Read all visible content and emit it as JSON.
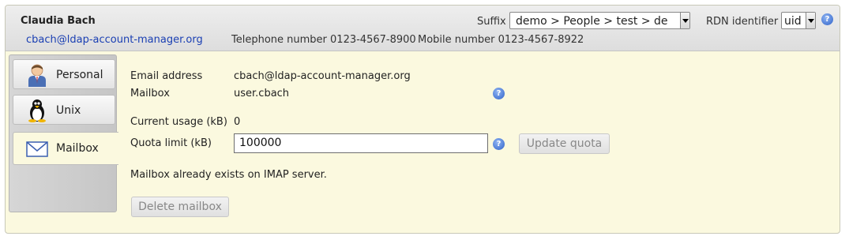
{
  "header": {
    "user_name": "Claudia Bach",
    "email": "cbach@ldap-account-manager.org",
    "telephone": "Telephone number 0123-4567-8900",
    "mobile": "Mobile number 0123-4567-8922",
    "suffix_label": "Suffix",
    "suffix_value": "demo > People > test > de",
    "rdn_label": "RDN identifier",
    "rdn_value": "uid",
    "help_glyph": "?"
  },
  "sidebar": {
    "items": [
      {
        "label": "Personal",
        "icon": "personal-user-icon"
      },
      {
        "label": "Unix",
        "icon": "tux-penguin-icon"
      },
      {
        "label": "Mailbox",
        "icon": "envelope-icon",
        "active": true
      }
    ]
  },
  "main": {
    "email_label": "Email address",
    "email_value": "cbach@ldap-account-manager.org",
    "mailbox_label": "Mailbox",
    "mailbox_value": "user.cbach",
    "usage_label": "Current usage (kB)",
    "usage_value": "0",
    "quota_label": "Quota limit (kB)",
    "quota_value": "100000",
    "update_quota_label": "Update quota",
    "status_message": "Mailbox already exists on IMAP server.",
    "delete_mailbox_label": "Delete mailbox"
  },
  "colors": {
    "panel_background": "#fbf9df",
    "link": "#1a3fb3",
    "help_icon": "#2f62c9"
  }
}
